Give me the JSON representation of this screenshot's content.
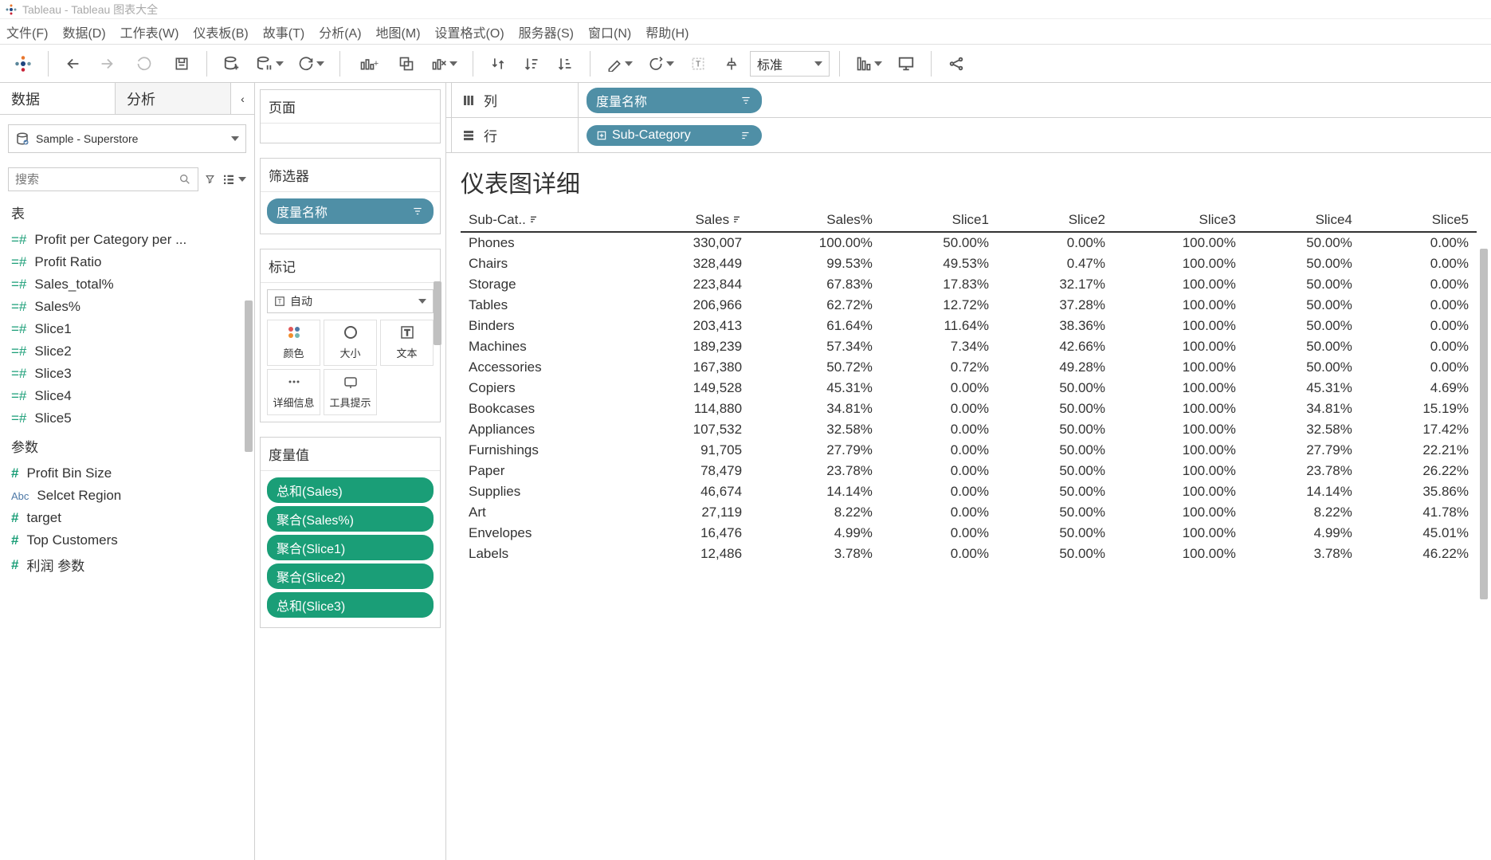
{
  "window": {
    "title": "Tableau - Tableau 图表大全"
  },
  "menu": [
    "文件(F)",
    "数据(D)",
    "工作表(W)",
    "仪表板(B)",
    "故事(T)",
    "分析(A)",
    "地图(M)",
    "设置格式(O)",
    "服务器(S)",
    "窗口(N)",
    "帮助(H)"
  ],
  "toolbar": {
    "fit_select": "标准"
  },
  "side": {
    "tabs": {
      "data": "数据",
      "analytics": "分析"
    },
    "datasource": "Sample - Superstore",
    "search_placeholder": "搜索",
    "tables_header": "表",
    "fields": [
      "Profit per Category per ...",
      "Profit Ratio",
      "Sales_total%",
      "Sales%",
      "Slice1",
      "Slice2",
      "Slice3",
      "Slice4",
      "Slice5"
    ],
    "params_header": "参数",
    "params": [
      {
        "icon": "hash",
        "label": "Profit Bin Size"
      },
      {
        "icon": "abc",
        "label": "Selcet Region"
      },
      {
        "icon": "hash",
        "label": "target"
      },
      {
        "icon": "hash",
        "label": "Top Customers"
      },
      {
        "icon": "hash",
        "label": "利润 参数"
      }
    ]
  },
  "mid": {
    "pages_title": "页面",
    "filters_title": "筛选器",
    "filter_pill": "度量名称",
    "marks_title": "标记",
    "mark_type": "自动",
    "mark_cells": [
      "颜色",
      "大小",
      "文本",
      "详细信息",
      "工具提示"
    ],
    "measures_title": "度量值",
    "measure_pills": [
      "总和(Sales)",
      "聚合(Sales%)",
      "聚合(Slice1)",
      "聚合(Slice2)",
      "总和(Slice3)"
    ]
  },
  "shelves": {
    "columns_label": "列",
    "columns_pill": "度量名称",
    "rows_label": "行",
    "rows_pill": "Sub-Category"
  },
  "viz": {
    "title": "仪表图详细",
    "columns": [
      "Sub-Cat..",
      "Sales",
      "Sales%",
      "Slice1",
      "Slice2",
      "Slice3",
      "Slice4",
      "Slice5"
    ],
    "rows": [
      {
        "c": "Phones",
        "v": [
          "330,007",
          "100.00%",
          "50.00%",
          "0.00%",
          "100.00%",
          "50.00%",
          "0.00%"
        ]
      },
      {
        "c": "Chairs",
        "v": [
          "328,449",
          "99.53%",
          "49.53%",
          "0.47%",
          "100.00%",
          "50.00%",
          "0.00%"
        ]
      },
      {
        "c": "Storage",
        "v": [
          "223,844",
          "67.83%",
          "17.83%",
          "32.17%",
          "100.00%",
          "50.00%",
          "0.00%"
        ]
      },
      {
        "c": "Tables",
        "v": [
          "206,966",
          "62.72%",
          "12.72%",
          "37.28%",
          "100.00%",
          "50.00%",
          "0.00%"
        ]
      },
      {
        "c": "Binders",
        "v": [
          "203,413",
          "61.64%",
          "11.64%",
          "38.36%",
          "100.00%",
          "50.00%",
          "0.00%"
        ]
      },
      {
        "c": "Machines",
        "v": [
          "189,239",
          "57.34%",
          "7.34%",
          "42.66%",
          "100.00%",
          "50.00%",
          "0.00%"
        ]
      },
      {
        "c": "Accessories",
        "v": [
          "167,380",
          "50.72%",
          "0.72%",
          "49.28%",
          "100.00%",
          "50.00%",
          "0.00%"
        ]
      },
      {
        "c": "Copiers",
        "v": [
          "149,528",
          "45.31%",
          "0.00%",
          "50.00%",
          "100.00%",
          "45.31%",
          "4.69%"
        ]
      },
      {
        "c": "Bookcases",
        "v": [
          "114,880",
          "34.81%",
          "0.00%",
          "50.00%",
          "100.00%",
          "34.81%",
          "15.19%"
        ]
      },
      {
        "c": "Appliances",
        "v": [
          "107,532",
          "32.58%",
          "0.00%",
          "50.00%",
          "100.00%",
          "32.58%",
          "17.42%"
        ]
      },
      {
        "c": "Furnishings",
        "v": [
          "91,705",
          "27.79%",
          "0.00%",
          "50.00%",
          "100.00%",
          "27.79%",
          "22.21%"
        ]
      },
      {
        "c": "Paper",
        "v": [
          "78,479",
          "23.78%",
          "0.00%",
          "50.00%",
          "100.00%",
          "23.78%",
          "26.22%"
        ]
      },
      {
        "c": "Supplies",
        "v": [
          "46,674",
          "14.14%",
          "0.00%",
          "50.00%",
          "100.00%",
          "14.14%",
          "35.86%"
        ]
      },
      {
        "c": "Art",
        "v": [
          "27,119",
          "8.22%",
          "0.00%",
          "50.00%",
          "100.00%",
          "8.22%",
          "41.78%"
        ]
      },
      {
        "c": "Envelopes",
        "v": [
          "16,476",
          "4.99%",
          "0.00%",
          "50.00%",
          "100.00%",
          "4.99%",
          "45.01%"
        ]
      },
      {
        "c": "Labels",
        "v": [
          "12,486",
          "3.78%",
          "0.00%",
          "50.00%",
          "100.00%",
          "3.78%",
          "46.22%"
        ]
      }
    ]
  },
  "chart_data": {
    "type": "table",
    "title": "仪表图详细",
    "columns": [
      "Sub-Category",
      "Sales",
      "Sales%",
      "Slice1",
      "Slice2",
      "Slice3",
      "Slice4",
      "Slice5"
    ],
    "data": [
      [
        "Phones",
        330007,
        100.0,
        50.0,
        0.0,
        100.0,
        50.0,
        0.0
      ],
      [
        "Chairs",
        328449,
        99.53,
        49.53,
        0.47,
        100.0,
        50.0,
        0.0
      ],
      [
        "Storage",
        223844,
        67.83,
        17.83,
        32.17,
        100.0,
        50.0,
        0.0
      ],
      [
        "Tables",
        206966,
        62.72,
        12.72,
        37.28,
        100.0,
        50.0,
        0.0
      ],
      [
        "Binders",
        203413,
        61.64,
        11.64,
        38.36,
        100.0,
        50.0,
        0.0
      ],
      [
        "Machines",
        189239,
        57.34,
        7.34,
        42.66,
        100.0,
        50.0,
        0.0
      ],
      [
        "Accessories",
        167380,
        50.72,
        0.72,
        49.28,
        100.0,
        50.0,
        0.0
      ],
      [
        "Copiers",
        149528,
        45.31,
        0.0,
        50.0,
        100.0,
        45.31,
        4.69
      ],
      [
        "Bookcases",
        114880,
        34.81,
        0.0,
        50.0,
        100.0,
        34.81,
        15.19
      ],
      [
        "Appliances",
        107532,
        32.58,
        0.0,
        50.0,
        100.0,
        32.58,
        17.42
      ],
      [
        "Furnishings",
        91705,
        27.79,
        0.0,
        50.0,
        100.0,
        27.79,
        22.21
      ],
      [
        "Paper",
        78479,
        23.78,
        0.0,
        50.0,
        100.0,
        23.78,
        26.22
      ],
      [
        "Supplies",
        46674,
        14.14,
        0.0,
        50.0,
        100.0,
        14.14,
        35.86
      ],
      [
        "Art",
        27119,
        8.22,
        0.0,
        50.0,
        100.0,
        8.22,
        41.78
      ],
      [
        "Envelopes",
        16476,
        4.99,
        0.0,
        50.0,
        100.0,
        4.99,
        45.01
      ],
      [
        "Labels",
        12486,
        3.78,
        0.0,
        50.0,
        100.0,
        3.78,
        46.22
      ]
    ]
  }
}
